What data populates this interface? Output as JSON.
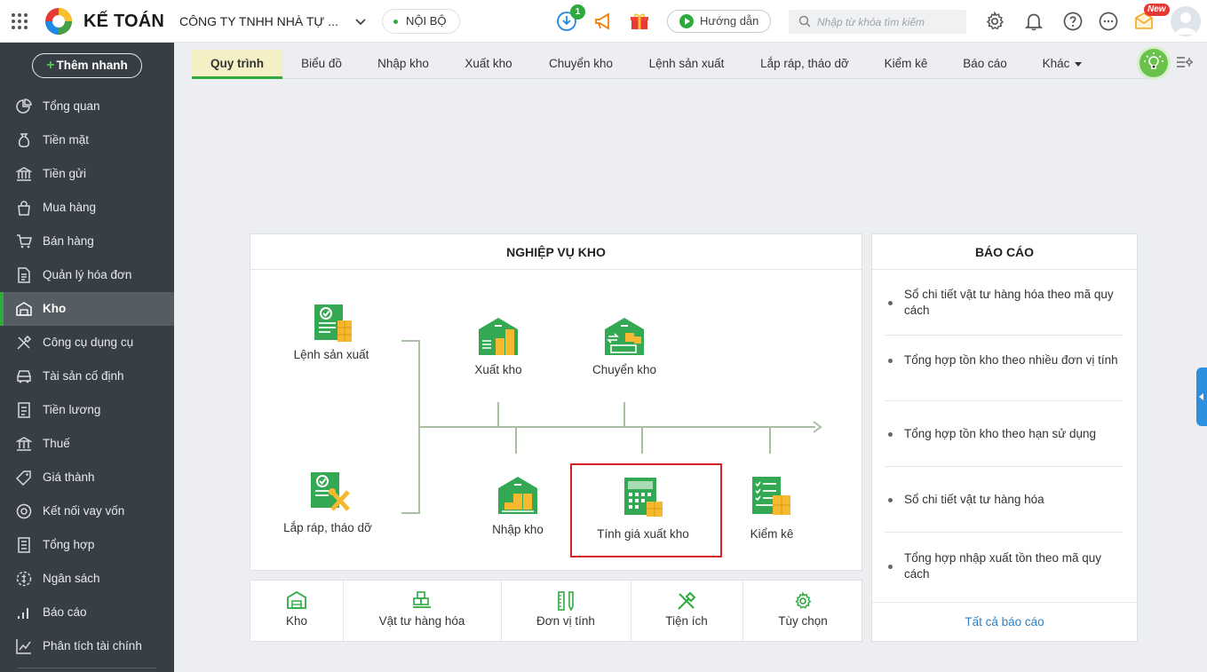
{
  "header": {
    "brand": "KẾ TOÁN",
    "company": "CÔNG TY TNHH NHÀ TỰ ...",
    "scope": "NỘI BỘ",
    "download_badge": "1",
    "guide_label": "Hướng dẫn",
    "search_placeholder": "Nhập từ khóa tìm kiếm",
    "new_badge": "New"
  },
  "sidebar": {
    "quick_add": "Thêm nhanh",
    "items": [
      {
        "label": "Tổng quan",
        "icon": "pie-chart-icon"
      },
      {
        "label": "Tiền mặt",
        "icon": "money-bag-icon"
      },
      {
        "label": "Tiền gửi",
        "icon": "bank-icon"
      },
      {
        "label": "Mua hàng",
        "icon": "shopping-bag-icon"
      },
      {
        "label": "Bán hàng",
        "icon": "cart-icon"
      },
      {
        "label": "Quản lý hóa đơn",
        "icon": "invoice-icon"
      },
      {
        "label": "Kho",
        "icon": "warehouse-icon",
        "active": true
      },
      {
        "label": "Công cụ dụng cụ",
        "icon": "tools-icon"
      },
      {
        "label": "Tài sản cố định",
        "icon": "car-icon"
      },
      {
        "label": "Tiền lương",
        "icon": "payroll-icon"
      },
      {
        "label": "Thuế",
        "icon": "tax-icon"
      },
      {
        "label": "Giá thành",
        "icon": "price-tag-icon"
      },
      {
        "label": "Kết nối vay vốn",
        "icon": "loan-icon"
      },
      {
        "label": "Tổng hợp",
        "icon": "summary-icon"
      },
      {
        "label": "Ngân sách",
        "icon": "budget-icon"
      },
      {
        "label": "Báo cáo",
        "icon": "bar-chart-icon"
      },
      {
        "label": "Phân tích tài chính",
        "icon": "analysis-icon"
      }
    ]
  },
  "tabs": [
    {
      "label": "Quy trình",
      "active": true
    },
    {
      "label": "Biểu đồ"
    },
    {
      "label": "Nhập kho"
    },
    {
      "label": "Xuất kho"
    },
    {
      "label": "Chuyển kho"
    },
    {
      "label": "Lệnh sản xuất"
    },
    {
      "label": "Lắp ráp, tháo dỡ"
    },
    {
      "label": "Kiểm kê"
    },
    {
      "label": "Báo cáo"
    },
    {
      "label": "Khác"
    }
  ],
  "workflow": {
    "title": "NGHIỆP VỤ KHO",
    "nodes": {
      "production_order": "Lệnh sản xuất",
      "assembly": "Lắp ráp, tháo dỡ",
      "issue": "Xuất kho",
      "transfer": "Chuyển kho",
      "receipt": "Nhập kho",
      "costing": "Tính giá xuất kho",
      "stocktake": "Kiểm kê"
    }
  },
  "reports": {
    "title": "BÁO CÁO",
    "items": [
      "Sổ chi tiết vật tư hàng hóa theo mã quy cách",
      "Tổng hợp tồn kho theo nhiều đơn vị tính",
      "Tổng hợp tồn kho theo hạn sử dụng",
      "Sổ chi tiết vật tư hàng hóa",
      "Tổng hợp nhập xuất tồn theo mã quy cách"
    ],
    "all_link": "Tất cả báo cáo"
  },
  "shortcuts": [
    {
      "label": "Kho",
      "icon": "warehouse-icon"
    },
    {
      "label": "Vật tư hàng hóa",
      "icon": "goods-icon"
    },
    {
      "label": "Đơn vị tính",
      "icon": "ruler-icon"
    },
    {
      "label": "Tiện ích",
      "icon": "utility-icon"
    },
    {
      "label": "Tùy chọn",
      "icon": "settings-gear-icon"
    }
  ],
  "colors": {
    "accent_green": "#2eaa3f",
    "sidebar_bg": "#383e45",
    "highlight_red": "#d92027",
    "link_blue": "#2d7fc1"
  }
}
